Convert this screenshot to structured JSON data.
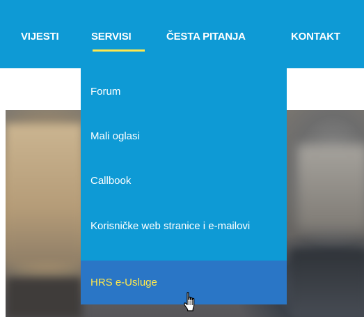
{
  "nav": {
    "items": [
      {
        "label": "VIJESTI"
      },
      {
        "label": "SERVISI"
      },
      {
        "label": "ČESTA PITANJA"
      },
      {
        "label": "KONTAKT"
      }
    ],
    "active_index": 1
  },
  "dropdown": {
    "items": [
      {
        "label": "Forum"
      },
      {
        "label": "Mali oglasi"
      },
      {
        "label": "Callbook"
      },
      {
        "label": "Korisničke web stranice i e-mailovi"
      },
      {
        "label": "HRS e-Usluge"
      }
    ],
    "hovered_index": 4
  },
  "colors": {
    "nav_bg": "#0e9ad5",
    "active_underline": "#ffe84d",
    "hover_bg": "#2a76c6",
    "hover_text": "#ffe84d",
    "text": "#ffffff"
  },
  "cursor": {
    "icon": "hand-pointer-icon"
  }
}
